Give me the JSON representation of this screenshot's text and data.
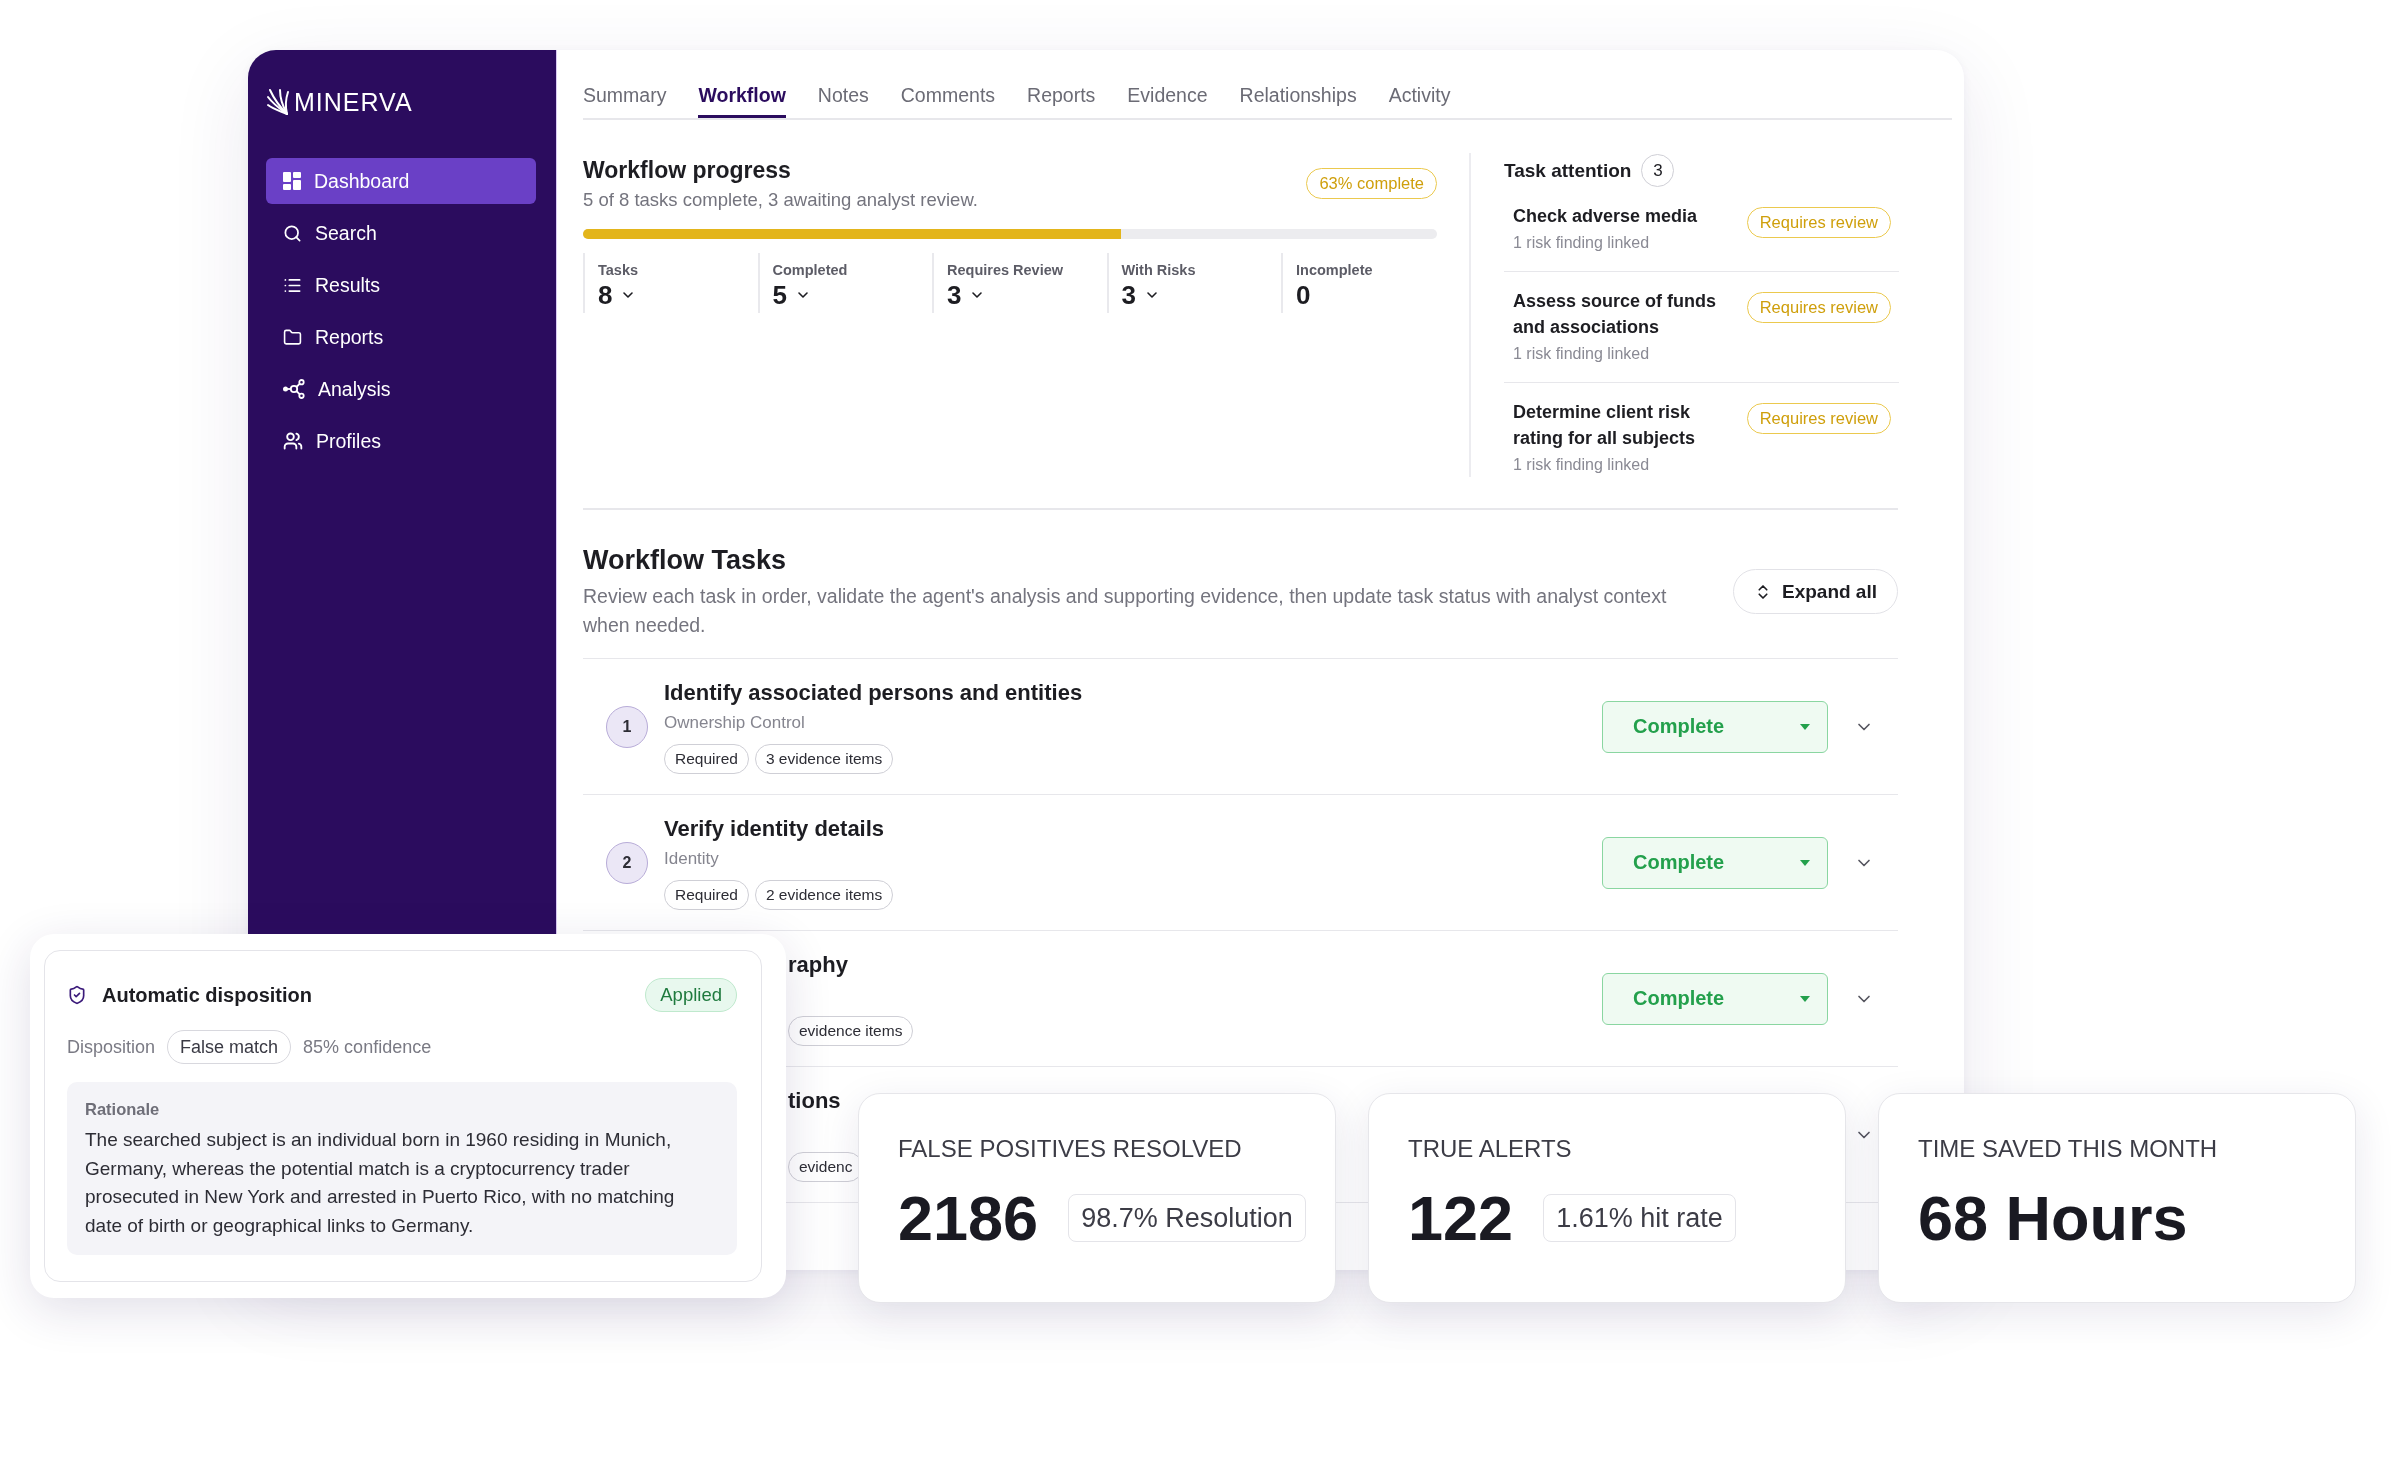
{
  "sidebar": {
    "logo": "MINERVA",
    "items": [
      {
        "label": "Dashboard",
        "selected": true
      },
      {
        "label": "Search",
        "selected": false
      },
      {
        "label": "Results",
        "selected": false
      },
      {
        "label": "Reports",
        "selected": false
      },
      {
        "label": "Analysis",
        "selected": false
      },
      {
        "label": "Profiles",
        "selected": false
      }
    ]
  },
  "tabs": [
    {
      "label": "Summary",
      "selected": false
    },
    {
      "label": "Workflow",
      "selected": true
    },
    {
      "label": "Notes",
      "selected": false
    },
    {
      "label": "Comments",
      "selected": false
    },
    {
      "label": "Reports",
      "selected": false
    },
    {
      "label": "Evidence",
      "selected": false
    },
    {
      "label": "Relationships",
      "selected": false
    },
    {
      "label": "Activity",
      "selected": false
    }
  ],
  "workflow_progress": {
    "title": "Workflow progress",
    "subtitle": "5 of 8 tasks complete, 3 awaiting analyst review.",
    "badge": "63% complete",
    "level": 0.63,
    "stats": [
      {
        "label": "Tasks",
        "value": "8",
        "expandable": true
      },
      {
        "label": "Completed",
        "value": "5",
        "expandable": true
      },
      {
        "label": "Requires Review",
        "value": "3",
        "expandable": true
      },
      {
        "label": "With Risks",
        "value": "3",
        "expandable": true
      },
      {
        "label": "Incomplete",
        "value": "0",
        "expandable": false
      }
    ]
  },
  "task_attention": {
    "title": "Task attention",
    "count": "3",
    "items": [
      {
        "title": "Check adverse media",
        "detail": "1 risk finding linked",
        "status": "Requires review"
      },
      {
        "title": "Assess source of funds and associations",
        "detail": "1 risk finding linked",
        "status": "Requires review"
      },
      {
        "title": "Determine client risk rating for all subjects",
        "detail": "1 risk finding linked",
        "status": "Requires review"
      }
    ]
  },
  "workflow_tasks": {
    "title": "Workflow Tasks",
    "description": "Review each task in order, validate the agent's analysis and supporting evidence, then update task status with analyst context when needed.",
    "expand_button": "Expand all",
    "tasks": [
      {
        "number": "1",
        "title": "Identify associated persons and entities",
        "category": "Ownership Control",
        "tags": [
          "Required",
          "3 evidence items"
        ],
        "status": "Complete",
        "expanded": false
      },
      {
        "number": "2",
        "title": "Verify identity details",
        "category": "Identity",
        "tags": [
          "Required",
          "2 evidence items"
        ],
        "status": "Complete",
        "expanded": false
      },
      {
        "title": "raphy",
        "tags": [
          "evidence items"
        ],
        "status": "Complete",
        "expanded": false
      },
      {
        "title": "tions",
        "tags": [
          "evidenc"
        ],
        "expanded": false
      }
    ]
  },
  "disposition_card": {
    "title": "Automatic disposition",
    "status": "Applied",
    "disposition_label": "Disposition",
    "disposition": "False match",
    "confidence": "85% confidence",
    "rationale_label": "Rationale",
    "rationale": "The searched subject is an individual born in 1960 residing in Munich, Germany, whereas the potential match is a cryptocurrency trader prosecuted in New York and arrested in Puerto Rico, with no matching date of birth or geographical links to Germany."
  },
  "stat_cards": [
    {
      "label": "FALSE POSITIVES RESOLVED",
      "value": "2186",
      "detail": "98.7% Resolution"
    },
    {
      "label": "TRUE ALERTS",
      "value": "122",
      "detail": "1.61% hit rate"
    },
    {
      "label": "TIME SAVED THIS MONTH",
      "value": "68 Hours"
    }
  ]
}
